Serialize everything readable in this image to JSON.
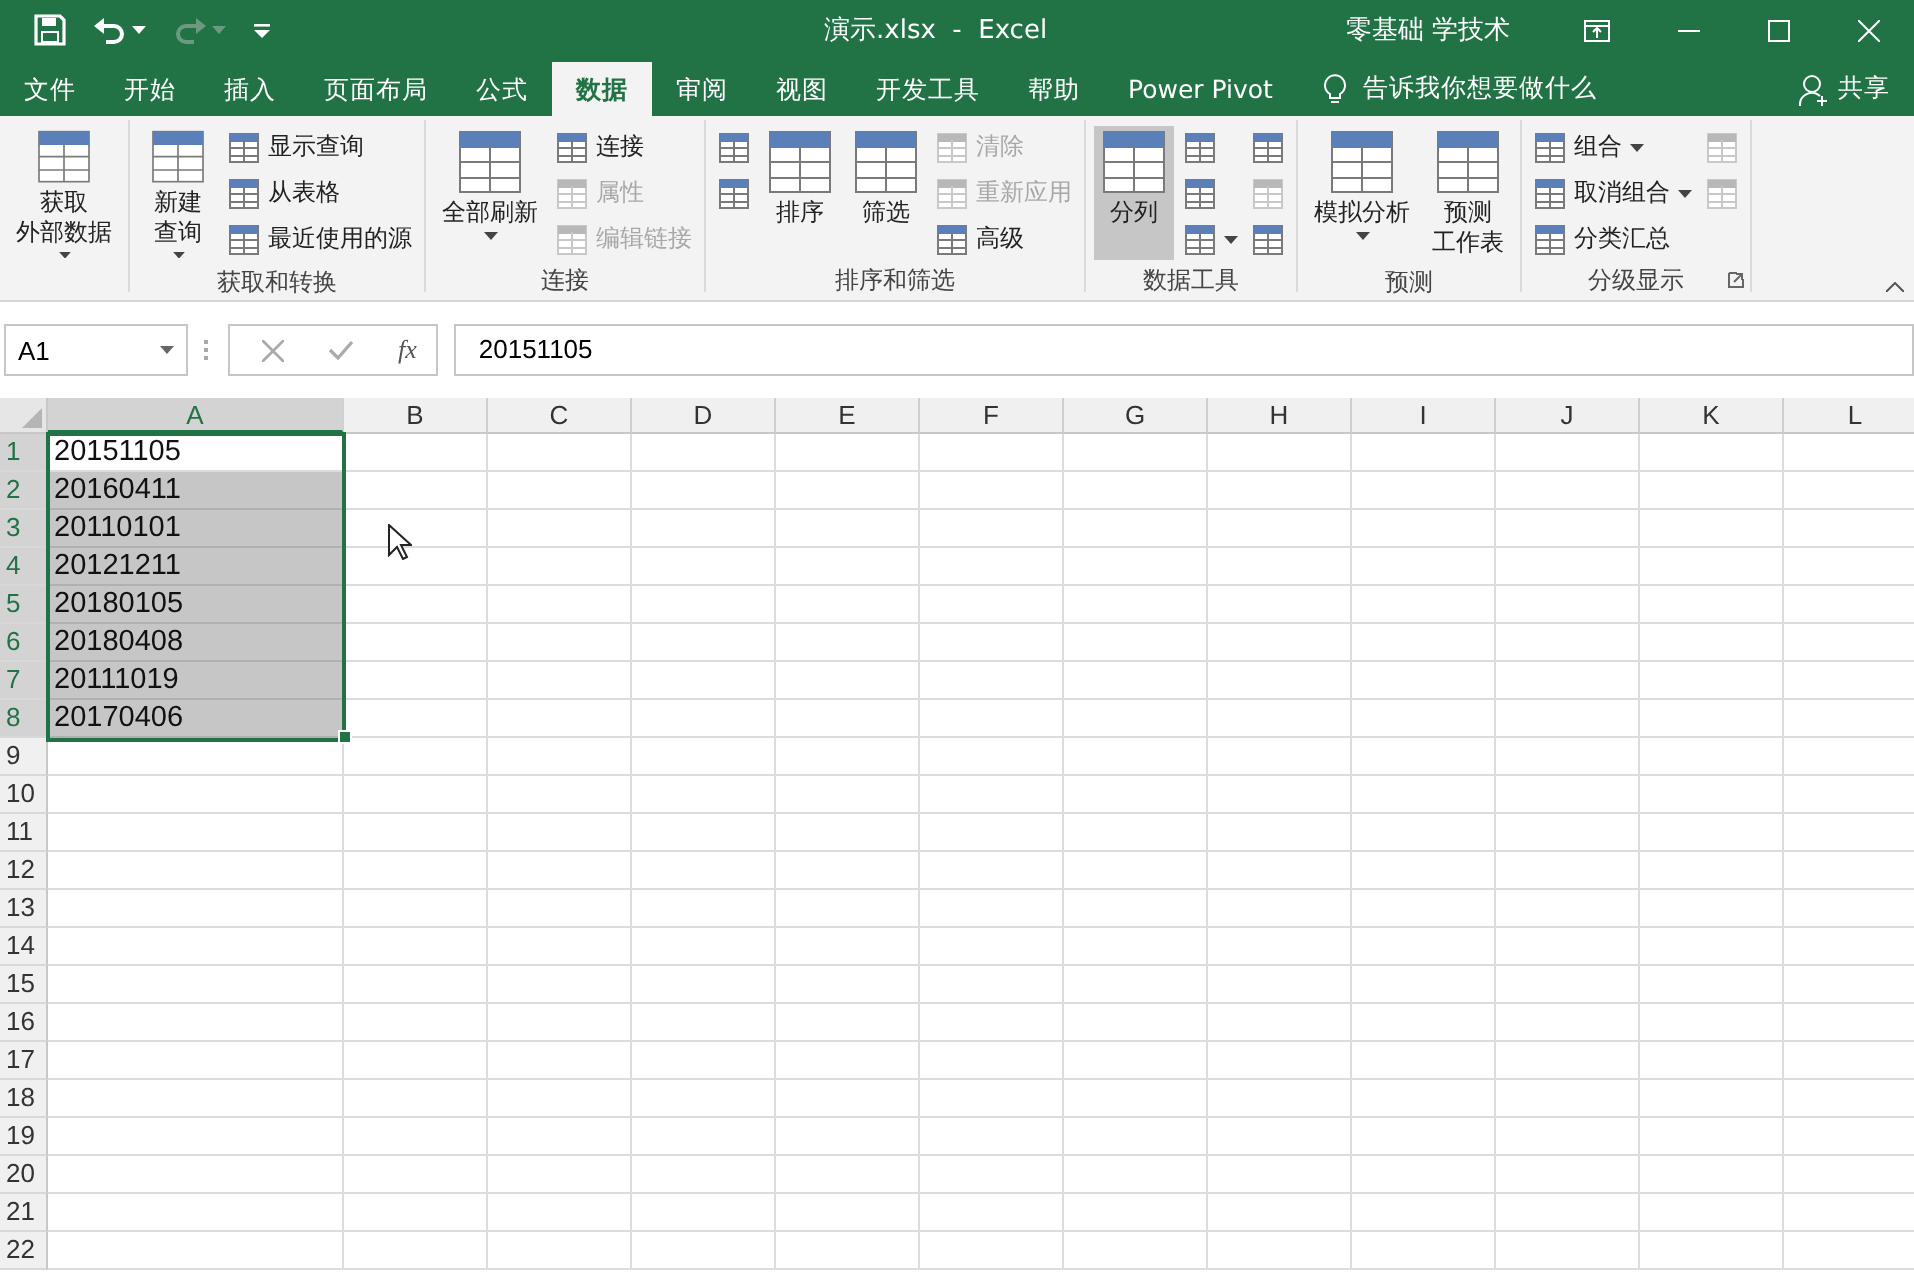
{
  "title_bar": {
    "title": "演示.xlsx  -  Excel",
    "user": "零基础 学技术"
  },
  "quick_access": [
    {
      "kind": "save",
      "disabled": false,
      "dropdown": false
    },
    {
      "kind": "undo",
      "disabled": false,
      "dropdown": true
    },
    {
      "kind": "redo",
      "disabled": true,
      "dropdown": true
    },
    {
      "kind": "customize",
      "disabled": false,
      "dropdown": false
    }
  ],
  "tabs": [
    {
      "label": "文件",
      "selected": false
    },
    {
      "label": "开始",
      "selected": false
    },
    {
      "label": "插入",
      "selected": false
    },
    {
      "label": "页面布局",
      "selected": false
    },
    {
      "label": "公式",
      "selected": false
    },
    {
      "label": "数据",
      "selected": true
    },
    {
      "label": "审阅",
      "selected": false
    },
    {
      "label": "视图",
      "selected": false
    },
    {
      "label": "开发工具",
      "selected": false
    },
    {
      "label": "帮助",
      "selected": false
    },
    {
      "label": "Power Pivot",
      "selected": false
    }
  ],
  "tell_me": {
    "placeholder": "告诉我你想要做什么"
  },
  "share": "共享",
  "ribbon": {
    "groups": [
      {
        "items": [
          {
            "kind": "large",
            "label": [
              "获取",
              "外部数据"
            ],
            "dropdown": true,
            "disabled": false,
            "selected": false
          }
        ]
      },
      {
        "label": "获取和转换",
        "items": [
          {
            "kind": "large",
            "label": [
              "新建",
              "查询"
            ],
            "dropdown": true,
            "disabled": false,
            "selected": false
          },
          {
            "kind": "small",
            "label": "显示查询",
            "dropdown": false,
            "disabled": false,
            "selected": false
          },
          {
            "kind": "small",
            "label": "从表格",
            "dropdown": false,
            "disabled": false,
            "selected": false
          },
          {
            "kind": "small",
            "label": "最近使用的源",
            "dropdown": false,
            "disabled": false,
            "selected": false
          }
        ]
      },
      {
        "label": "连接",
        "items": [
          {
            "kind": "large",
            "label": [
              "全部刷新"
            ],
            "dropdown": true,
            "disabled": false,
            "selected": false
          },
          {
            "kind": "small",
            "label": "连接",
            "dropdown": false,
            "disabled": false,
            "selected": false
          },
          {
            "kind": "small",
            "label": "属性",
            "dropdown": false,
            "disabled": true,
            "selected": false
          },
          {
            "kind": "small",
            "label": "编辑链接",
            "dropdown": false,
            "disabled": true,
            "selected": false
          }
        ]
      },
      {
        "label": "排序和筛选",
        "items": [
          {
            "kind": "small",
            "dropdown": false,
            "disabled": false,
            "selected": false
          },
          {
            "kind": "small",
            "dropdown": false,
            "disabled": false,
            "selected": false
          },
          {
            "kind": "large",
            "label": [
              "排序"
            ],
            "dropdown": false,
            "disabled": false,
            "selected": false
          },
          {
            "kind": "large",
            "label": [
              "筛选"
            ],
            "dropdown": false,
            "disabled": false,
            "selected": false
          },
          {
            "kind": "small",
            "label": "清除",
            "dropdown": false,
            "disabled": true,
            "selected": false
          },
          {
            "kind": "small",
            "label": "重新应用",
            "dropdown": false,
            "disabled": true,
            "selected": false
          },
          {
            "kind": "small",
            "label": "高级",
            "dropdown": false,
            "disabled": false,
            "selected": false
          }
        ]
      },
      {
        "label": "数据工具",
        "items": [
          {
            "kind": "large",
            "label": [
              "分列"
            ],
            "dropdown": false,
            "disabled": false,
            "selected": true
          },
          {
            "kind": "small",
            "dropdown": false,
            "disabled": false,
            "selected": false
          },
          {
            "kind": "small",
            "dropdown": false,
            "disabled": false,
            "selected": false
          },
          {
            "kind": "small",
            "dropdown": true,
            "disabled": false,
            "selected": false
          },
          {
            "kind": "small",
            "dropdown": false,
            "disabled": false,
            "selected": false
          },
          {
            "kind": "small",
            "dropdown": false,
            "disabled": true,
            "selected": false
          },
          {
            "kind": "small",
            "dropdown": false,
            "disabled": false,
            "selected": false
          }
        ]
      },
      {
        "label": "预测",
        "items": [
          {
            "kind": "large",
            "label": [
              "模拟分析"
            ],
            "dropdown": true,
            "disabled": false,
            "selected": false
          },
          {
            "kind": "large",
            "label": [
              "预测",
              "工作表"
            ],
            "dropdown": false,
            "disabled": false,
            "selected": false
          }
        ]
      },
      {
        "label": "分级显示",
        "launcher": true,
        "items": [
          {
            "kind": "small",
            "label": "组合",
            "dropdown": true,
            "disabled": false,
            "selected": false
          },
          {
            "kind": "small",
            "label": "取消组合",
            "dropdown": true,
            "disabled": false,
            "selected": false
          },
          {
            "kind": "small",
            "label": "分类汇总",
            "dropdown": false,
            "disabled": false,
            "selected": false
          },
          {
            "kind": "small",
            "dropdown": false,
            "disabled": true,
            "selected": false
          },
          {
            "kind": "small",
            "dropdown": false,
            "disabled": true,
            "selected": false
          }
        ]
      }
    ]
  },
  "formula_bar": {
    "name_box": "A1",
    "function_label": "fx",
    "value": "20151105"
  },
  "sheet": {
    "columns": [
      {
        "label": "A",
        "selected": true
      },
      {
        "label": "B",
        "selected": false
      },
      {
        "label": "C",
        "selected": false
      },
      {
        "label": "D",
        "selected": false
      },
      {
        "label": "E",
        "selected": false
      },
      {
        "label": "F",
        "selected": false
      },
      {
        "label": "G",
        "selected": false
      },
      {
        "label": "H",
        "selected": false
      },
      {
        "label": "I",
        "selected": false
      },
      {
        "label": "J",
        "selected": false
      },
      {
        "label": "K",
        "selected": false
      },
      {
        "label": "L",
        "selected": false
      }
    ],
    "rows": [
      {
        "header": "1",
        "value": "20151105",
        "selected": true,
        "active": true
      },
      {
        "header": "2",
        "value": "20160411",
        "selected": true,
        "active": false
      },
      {
        "header": "3",
        "value": "20110101",
        "selected": true,
        "active": false
      },
      {
        "header": "4",
        "value": "20121211",
        "selected": true,
        "active": false
      },
      {
        "header": "5",
        "value": "20180105",
        "selected": true,
        "active": false
      },
      {
        "header": "6",
        "value": "20180408",
        "selected": true,
        "active": false
      },
      {
        "header": "7",
        "value": "20111019",
        "selected": true,
        "active": false
      },
      {
        "header": "8",
        "value": "20170406",
        "selected": true,
        "active": false
      },
      {
        "header": "9",
        "selected": false,
        "active": false
      },
      {
        "header": "10",
        "selected": false,
        "active": false
      },
      {
        "header": "11",
        "selected": false,
        "active": false
      },
      {
        "header": "12",
        "selected": false,
        "active": false
      },
      {
        "header": "13",
        "selected": false,
        "active": false
      },
      {
        "header": "14",
        "selected": false,
        "active": false
      },
      {
        "header": "15",
        "selected": false,
        "active": false
      },
      {
        "header": "16",
        "selected": false,
        "active": false
      },
      {
        "header": "17",
        "selected": false,
        "active": false
      },
      {
        "header": "18",
        "selected": false,
        "active": false
      },
      {
        "header": "19",
        "selected": false,
        "active": false
      },
      {
        "header": "20",
        "selected": false,
        "active": false
      },
      {
        "header": "21",
        "selected": false,
        "active": false
      },
      {
        "header": "22",
        "selected": false,
        "active": false
      }
    ]
  }
}
